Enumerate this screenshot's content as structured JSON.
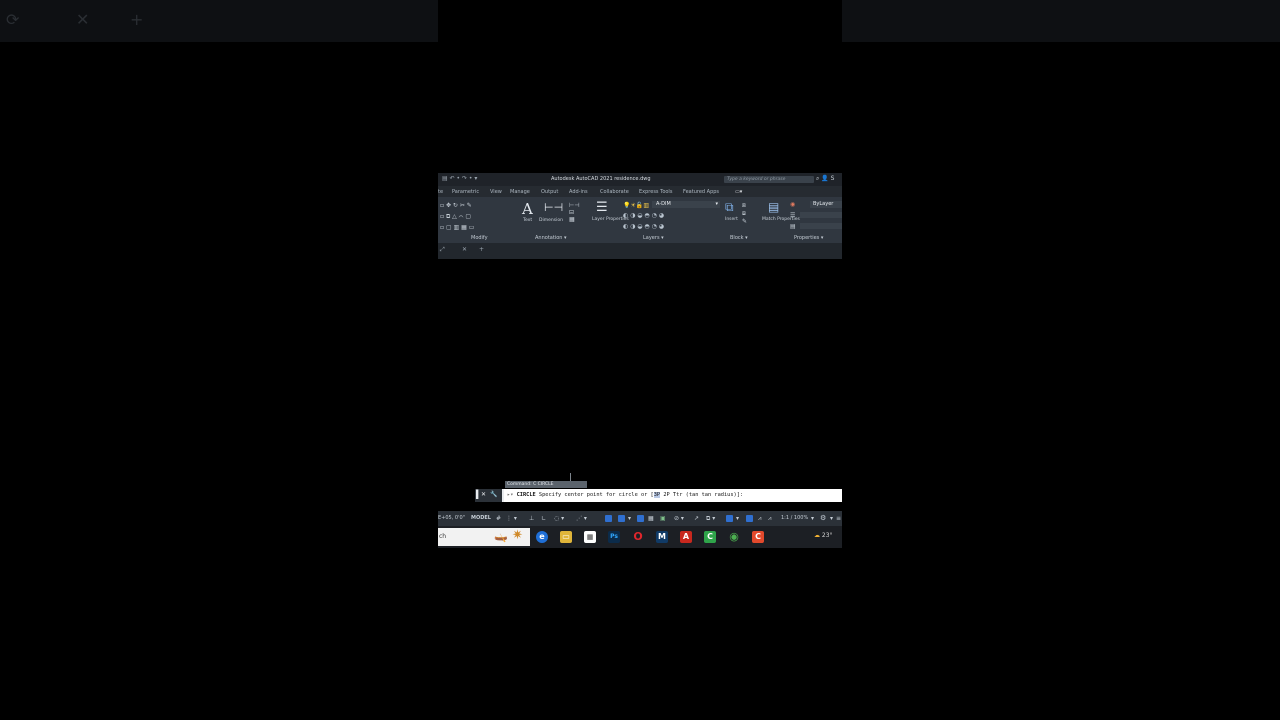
{
  "app": {
    "title": "Autodesk AutoCAD 2021   residence.dwg",
    "search_placeholder": "Type a keyword or phrase",
    "quick_access": "▤  ↶ •  ↷ •  ▾"
  },
  "ribbon_tabs": [
    "te",
    "Parametric",
    "View",
    "Manage",
    "Output",
    "Add-ins",
    "Collaborate",
    "Express Tools",
    "Featured Apps"
  ],
  "ribbon": {
    "text_label": "Text",
    "dimension_label": "Dimension",
    "layer_properties_label": "Layer Properties",
    "layer_name": "A-DIM",
    "insert_label": "Insert",
    "match_properties_label": "Match Properties",
    "bylayer": "ByLayer",
    "panels": {
      "modify": "Modify",
      "annotation": "Annotation",
      "layers": "Layers",
      "block": "Block",
      "properties": "Properties"
    }
  },
  "command": {
    "history": "Command: C CIRCLE",
    "prompt_name": "CIRCLE",
    "prompt_text": "Specify center point for circle or [",
    "options": [
      "3P",
      "2P",
      "Ttr (tan tan radius)"
    ],
    "prompt_end": "]:"
  },
  "status": {
    "coords": "E+05, 0'0\"",
    "model_tab": "MODEL",
    "scale": "1:1 / 100%"
  },
  "taskbar": {
    "search_text": "ch",
    "tray_temp": "23°"
  },
  "colors": {
    "autocad_red": "#c8281e",
    "accent_blue": "#2f6fd0",
    "ribbon_bg": "#303740"
  }
}
